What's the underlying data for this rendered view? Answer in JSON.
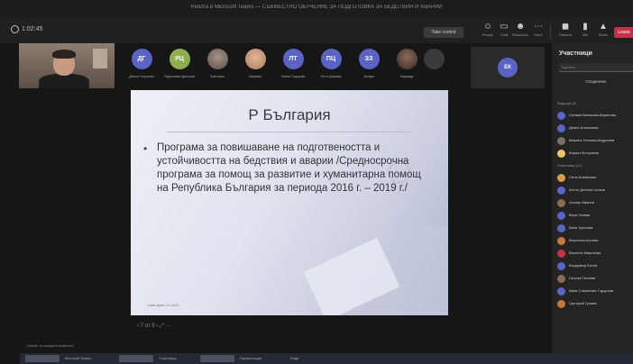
{
  "window": {
    "title": "Работа в Microsoft Teams — СЪВМЕСТНО ОБУЧЕНИЕ ЗА ПОДГОТОВКА ЗА БЕДСТВИЯ И АВАРИИ"
  },
  "toolbar": {
    "timer": "1:02:45",
    "take_control_label": "Take control",
    "buttons": [
      {
        "label": "People",
        "icon": "people-icon",
        "glyph": "☺"
      },
      {
        "label": "Chat",
        "icon": "chat-icon",
        "glyph": "▭"
      },
      {
        "label": "Reactions",
        "icon": "reactions-icon",
        "glyph": "☻"
      },
      {
        "label": "More",
        "icon": "more-icon",
        "glyph": "⋯"
      },
      {
        "label": "Camera",
        "icon": "camera-icon",
        "glyph": "◼"
      },
      {
        "label": "Mic",
        "icon": "mic-icon",
        "glyph": "▮"
      },
      {
        "label": "Share",
        "icon": "share-icon",
        "glyph": "▲"
      }
    ],
    "leave_label": "Leave"
  },
  "participants": [
    {
      "initials": "ДГ",
      "name": "Деяна Георгиева",
      "color": "#5b64c4"
    },
    {
      "initials": "РЦ",
      "name": "Радослава Цветкова",
      "color": "#8fae4f"
    },
    {
      "initials": "",
      "name": "Виктория",
      "color": "#6f6a66"
    },
    {
      "initials": "",
      "name": "Марийка",
      "color": "#b07a5a"
    },
    {
      "initials": "ЛТ",
      "name": "Лилия Тодорова",
      "color": "#5b64c4"
    },
    {
      "initials": "ПЦ",
      "name": "Петя Цанкова",
      "color": "#5b64c4"
    },
    {
      "initials": "ЗЗ",
      "name": "Захари",
      "color": "#5b64c4"
    },
    {
      "initials": "",
      "name": "Надежда",
      "color": "#4f3d33"
    }
  ],
  "speaker": {
    "initials": "ЕК"
  },
  "slide": {
    "title": "Р България",
    "bullet_text": "Програма за повишаване на подготвеността и устойчивостта на бедствия и аварии /Средносрочна програма за помощ за развитие и хуманитарна помощ на Република България за периода 2016 г. – 2019 г./",
    "footer": "Сава Дамс 21 2021"
  },
  "slide_controls": {
    "text": "‹  7 от 9  ›   ⤢ ···"
  },
  "panel": {
    "title": "Участници",
    "search_placeholder": "Търсене",
    "share_label": "Споделяне",
    "section_presenters": "Водещи (4)",
    "section_attendees": "Участници (17)",
    "presenters": [
      {
        "name": "Силвия Великова-Кирилова",
        "color": "#5b64c4"
      },
      {
        "name": "Деяна Алексиева",
        "color": "#5b64c4"
      },
      {
        "name": "Марина Генчева-Андреева",
        "color": "#7a6f6a"
      },
      {
        "name": "Кирилл Ботушков",
        "color": "#e8c46a"
      }
    ],
    "attendees": [
      {
        "name": "Петя Атанасова",
        "color": "#d4a04a"
      },
      {
        "name": "Антон Дончев Чочков",
        "color": "#5b64c4"
      },
      {
        "name": "Атанас Иванов",
        "color": "#8a6a58"
      },
      {
        "name": "Вера Ганева",
        "color": "#5b64c4"
      },
      {
        "name": "Ваня Хранова",
        "color": "#5b64c4"
      },
      {
        "name": "Вероника Колева",
        "color": "#c47a3a"
      },
      {
        "name": "Виолета Маринова",
        "color": "#c4314b"
      },
      {
        "name": "Владимир Ботев",
        "color": "#5b64c4"
      },
      {
        "name": "Галина Ганчева",
        "color": "#8a6a58"
      },
      {
        "name": "Ваня Стаматова Тодорова",
        "color": "#5b64c4"
      },
      {
        "name": "Григорий Гулаев",
        "color": "#c47a3a"
      }
    ]
  },
  "chat_line": "Никой не говори в момента",
  "taskbar": {
    "items": [
      "Microsoft Teams",
      "Участници",
      "Презентация",
      "Edge"
    ]
  }
}
